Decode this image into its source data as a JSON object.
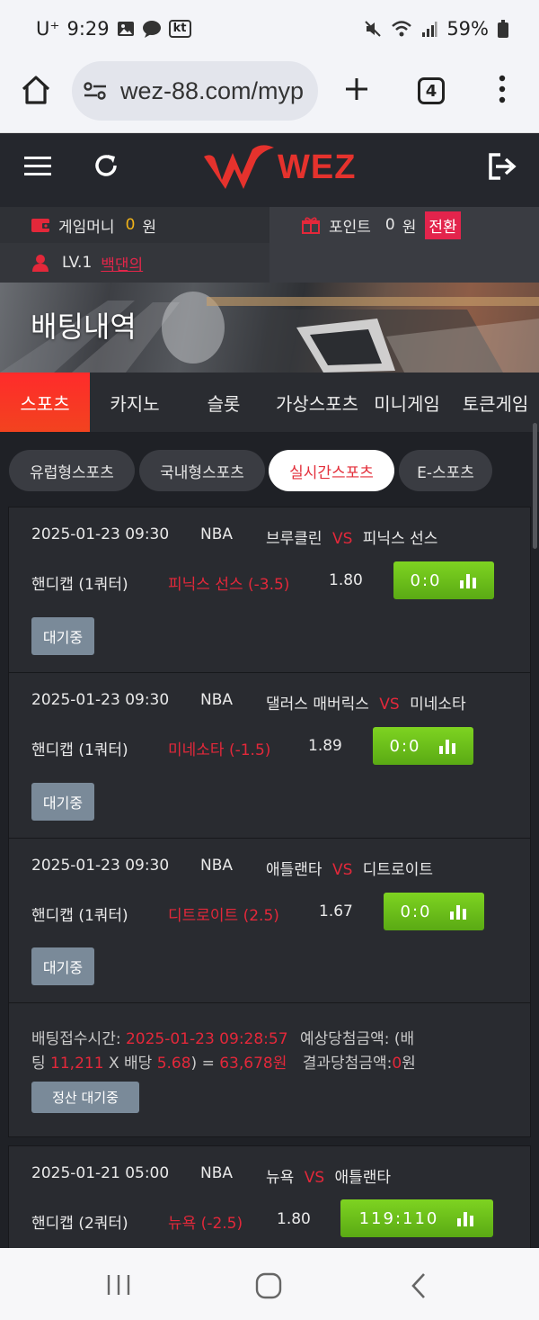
{
  "status_bar": {
    "carrier": "U⁺",
    "time": "9:29",
    "kt_label": "kt",
    "battery": "59%"
  },
  "browser": {
    "url": "wez-88.com/myp",
    "tab_count": "4"
  },
  "header": {
    "logo_text": "WEZ"
  },
  "account": {
    "game_money_label": "게임머니",
    "game_money_value": "0",
    "won": "원",
    "point_label": "포인트",
    "point_value": "0",
    "convert_label": "전환",
    "level": "LV.1",
    "nickname": "백댄의"
  },
  "banner": {
    "title": "배팅내역"
  },
  "category_tabs": [
    "스포츠",
    "카지노",
    "슬롯",
    "가상스포츠",
    "미니게임",
    "토큰게임"
  ],
  "sub_tabs": [
    "유럽형스포츠",
    "국내형스포츠",
    "실시간스포츠",
    "E-스포츠"
  ],
  "bets": [
    {
      "datetime": "2025-01-23 09:30",
      "league": "NBA",
      "home": "브루클린",
      "vs": "VS",
      "away": "피닉스 선스",
      "market": "핸디캡 (1쿼터)",
      "pick": "피닉스 선스 (-3.5)",
      "odds": "1.80",
      "score": "0:0",
      "status": "대기중"
    },
    {
      "datetime": "2025-01-23 09:30",
      "league": "NBA",
      "home": "댈러스 매버릭스",
      "vs": "VS",
      "away": "미네소타",
      "market": "핸디캡 (1쿼터)",
      "pick": "미네소타 (-1.5)",
      "odds": "1.89",
      "score": "0:0",
      "status": "대기중"
    },
    {
      "datetime": "2025-01-23 09:30",
      "league": "NBA",
      "home": "애틀랜타",
      "vs": "VS",
      "away": "디트로이트",
      "market": "핸디캡 (1쿼터)",
      "pick": "디트로이트 (2.5)",
      "odds": "1.67",
      "score": "0:0",
      "status": "대기중"
    }
  ],
  "summary": {
    "time_label": "배팅접수시간:",
    "time_value": "2025-01-23 09:28:57",
    "expected_label": "예상당첨금액: (배",
    "bet_prefix": "팅",
    "bet_amount": "11,211",
    "x_odds": "X 배당",
    "total_odds": "5.68",
    "eq": ") =",
    "payout": "63,678원",
    "result_label": "결과당첨금액:",
    "result_value": "0",
    "result_unit": "원",
    "settle_button": "정산 대기중"
  },
  "bet2": {
    "datetime": "2025-01-21 05:00",
    "league": "NBA",
    "home": "뉴욕",
    "vs": "VS",
    "away": "애틀랜타",
    "market": "핸디캡 (2쿼터)",
    "pick": "뉴욕 (-2.5)",
    "odds": "1.80",
    "score": "119:110"
  },
  "colors": {
    "accent_red": "#e3283a",
    "score_green": "#6cc11b",
    "money_yellow": "#f2b318",
    "page_bg": "#1f2126"
  }
}
